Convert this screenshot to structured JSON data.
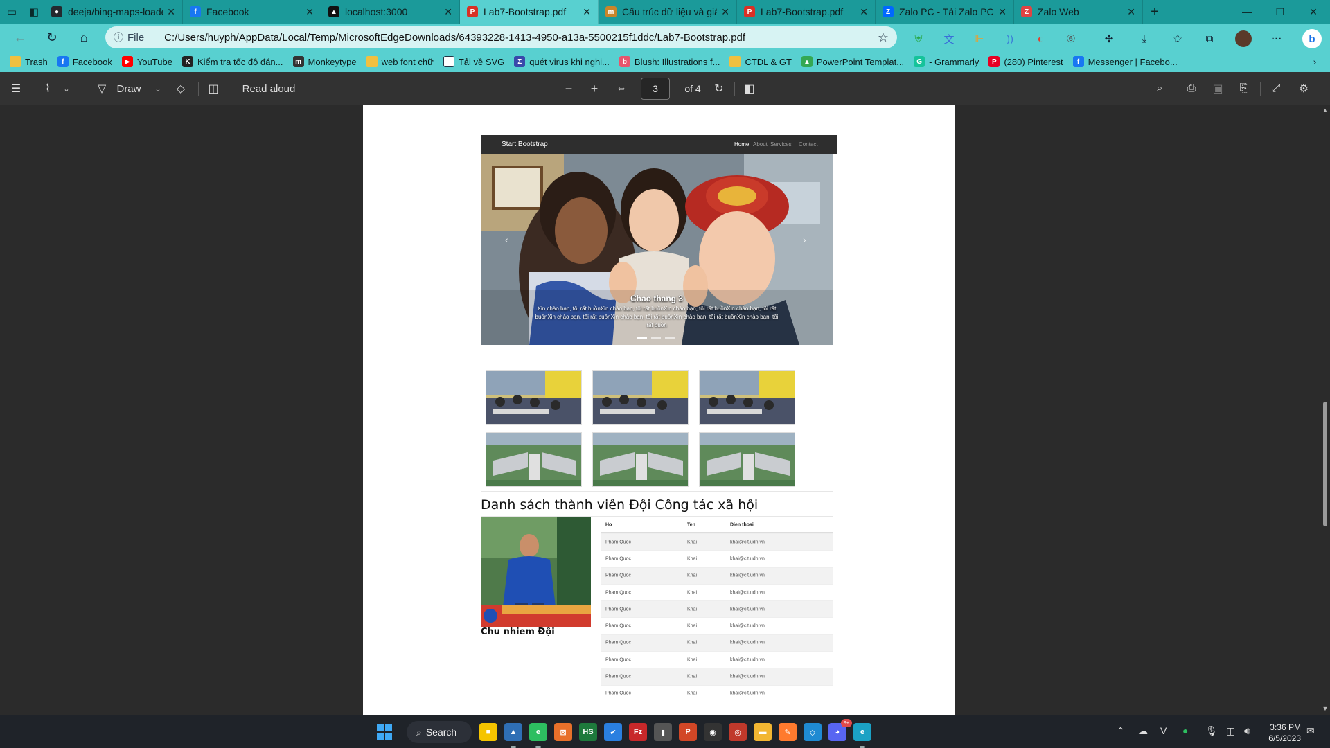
{
  "tabs": [
    {
      "title": "deeja/bing-maps-loade",
      "icon": "github-icon",
      "color": "#24292e",
      "glyph": "●"
    },
    {
      "title": "Facebook",
      "icon": "facebook-icon",
      "color": "#1877f2",
      "glyph": "f"
    },
    {
      "title": "localhost:3000",
      "icon": "react-icon",
      "color": "#111111",
      "glyph": "▲"
    },
    {
      "title": "Lab7-Bootstrap.pdf",
      "icon": "pdf-icon",
      "color": "#d93025",
      "glyph": "P",
      "active": true
    },
    {
      "title": "Cấu trúc dữ liệu và giải",
      "icon": "site-icon",
      "color": "#c9852a",
      "glyph": "m"
    },
    {
      "title": "Lab7-Bootstrap.pdf",
      "icon": "pdf-icon",
      "color": "#d93025",
      "glyph": "P"
    },
    {
      "title": "Zalo PC - Tải Zalo PC dể",
      "icon": "zalo-icon",
      "color": "#0068ff",
      "glyph": "Z"
    },
    {
      "title": "Zalo Web",
      "icon": "zalo-icon",
      "color": "#e04444",
      "glyph": "Z"
    }
  ],
  "address": {
    "scheme_label": "File",
    "url": "C:/Users/huyph/AppData/Local/Temp/MicrosoftEdgeDownloads/64393228-1413-4950-a13a-5500215f1ddc/Lab7-Bootstrap.pdf"
  },
  "bookmarks": [
    {
      "label": "Trash",
      "icon": "folder-icon",
      "color": "#f0c040",
      "glyph": ""
    },
    {
      "label": "Facebook",
      "icon": "facebook-icon",
      "color": "#1877f2",
      "glyph": "f"
    },
    {
      "label": "YouTube",
      "icon": "youtube-icon",
      "color": "#ff0000",
      "glyph": "▶"
    },
    {
      "label": "Kiểm tra tốc độ đán...",
      "icon": "keyboard-icon",
      "color": "#222222",
      "glyph": "K"
    },
    {
      "label": "Monkeytype",
      "icon": "monkeytype-icon",
      "color": "#333333",
      "glyph": "m"
    },
    {
      "label": "web font chữ",
      "icon": "folder-icon",
      "color": "#f0c040",
      "glyph": ""
    },
    {
      "label": "Tải về SVG",
      "icon": "page-icon",
      "color": "#ffffff",
      "glyph": ""
    },
    {
      "label": "quét virus khi nghi...",
      "icon": "virustotal-icon",
      "color": "#3949ab",
      "glyph": "Σ"
    },
    {
      "label": "Blush: Illustrations f...",
      "icon": "blush-icon",
      "color": "#e8556d",
      "glyph": "b"
    },
    {
      "label": "CTDL & GT",
      "icon": "folder-icon",
      "color": "#f0c040",
      "glyph": ""
    },
    {
      "label": "PowerPoint Templat...",
      "icon": "drive-icon",
      "color": "#34a853",
      "glyph": "▲"
    },
    {
      "label": "- Grammarly",
      "icon": "grammarly-icon",
      "color": "#15c39a",
      "glyph": "G"
    },
    {
      "label": "(280) Pinterest",
      "icon": "pinterest-icon",
      "color": "#e60023",
      "glyph": "P"
    },
    {
      "label": "Messenger | Facebo...",
      "icon": "facebook-icon",
      "color": "#1877f2",
      "glyph": "f"
    }
  ],
  "pdf_toolbar": {
    "draw_label": "Draw",
    "read_aloud_label": "Read aloud",
    "page_current": "3",
    "page_total": "of 4"
  },
  "document": {
    "nav": {
      "brand": "Start Bootstrap",
      "links": [
        "Home",
        "About",
        "Services",
        "Contact"
      ]
    },
    "carousel": {
      "title": "Chao thang 3",
      "text": "Xin chào bạn, tôi rất buồnXin chào bạn, tôi rất buồnXin chào bạn, tôi rất buồnXin chào bạn, tôi rất buồnXin chào bạn, tôi rất buồnXin chào bạn, tôi rất buồnXin chào bạn, tôi rất buồnXin chào bạn, tôi rất buồn"
    },
    "section_title": "Danh sách thành viên Đội Công tác xã hội",
    "profile_caption": "Chu nhiem Đội",
    "table": {
      "headers": [
        "Ho",
        "Ten",
        "Dien thoai"
      ],
      "rows": [
        [
          "Pham Quoc",
          "Khai",
          "khai@cit.udn.vn"
        ],
        [
          "Pham Quoc",
          "Khai",
          "khai@cit.udn.vn"
        ],
        [
          "Pham Quoc",
          "Khai",
          "khai@cit.udn.vn"
        ],
        [
          "Pham Quoc",
          "Khai",
          "khai@cit.udn.vn"
        ],
        [
          "Pham Quoc",
          "Khai",
          "khai@cit.udn.vn"
        ],
        [
          "Pham Quoc",
          "Khai",
          "khai@cit.udn.vn"
        ],
        [
          "Pham Quoc",
          "Khai",
          "khai@cit.udn.vn"
        ],
        [
          "Pham Quoc",
          "Khai",
          "khai@cit.udn.vn"
        ],
        [
          "Pham Quoc",
          "Khai",
          "khai@cit.udn.vn"
        ],
        [
          "Pham Quoc",
          "Khai",
          "khai@cit.udn.vn"
        ]
      ]
    }
  },
  "taskbar": {
    "search_label": "Search",
    "apps": [
      {
        "name": "sticky-notes-icon",
        "color": "#f5c400",
        "glyph": "■"
      },
      {
        "name": "photos-icon",
        "color": "#2f6fb5",
        "glyph": "▲"
      },
      {
        "name": "evernote-icon",
        "color": "#2dbe60",
        "glyph": "e"
      },
      {
        "name": "app-orange-icon",
        "color": "#e8702a",
        "glyph": "⊠"
      },
      {
        "name": "hs-icon",
        "color": "#1e7a3c",
        "glyph": "HS"
      },
      {
        "name": "todo-icon",
        "color": "#2a7fe0",
        "glyph": "✔"
      },
      {
        "name": "filezilla-icon",
        "color": "#c8282a",
        "glyph": "Fz"
      },
      {
        "name": "podcast-icon",
        "color": "#555555",
        "glyph": "▮"
      },
      {
        "name": "powerpoint-icon",
        "color": "#d24726",
        "glyph": "P"
      },
      {
        "name": "game-icon",
        "color": "#333333",
        "glyph": "◉"
      },
      {
        "name": "davinci-icon",
        "color": "#c0392b",
        "glyph": "◎"
      },
      {
        "name": "file-explorer-icon",
        "color": "#f2b632",
        "glyph": "▬"
      },
      {
        "name": "sublime-icon",
        "color": "#ff7a2e",
        "glyph": "✎"
      },
      {
        "name": "vscode-icon",
        "color": "#1f8ad2",
        "glyph": "◇"
      },
      {
        "name": "discord-icon",
        "color": "#5865f2",
        "glyph": "◕"
      },
      {
        "name": "edge-icon",
        "color": "#1ba1c4",
        "glyph": "e"
      }
    ],
    "time": "3:36 PM",
    "date": "6/5/2023",
    "discord_badge": "9+"
  }
}
